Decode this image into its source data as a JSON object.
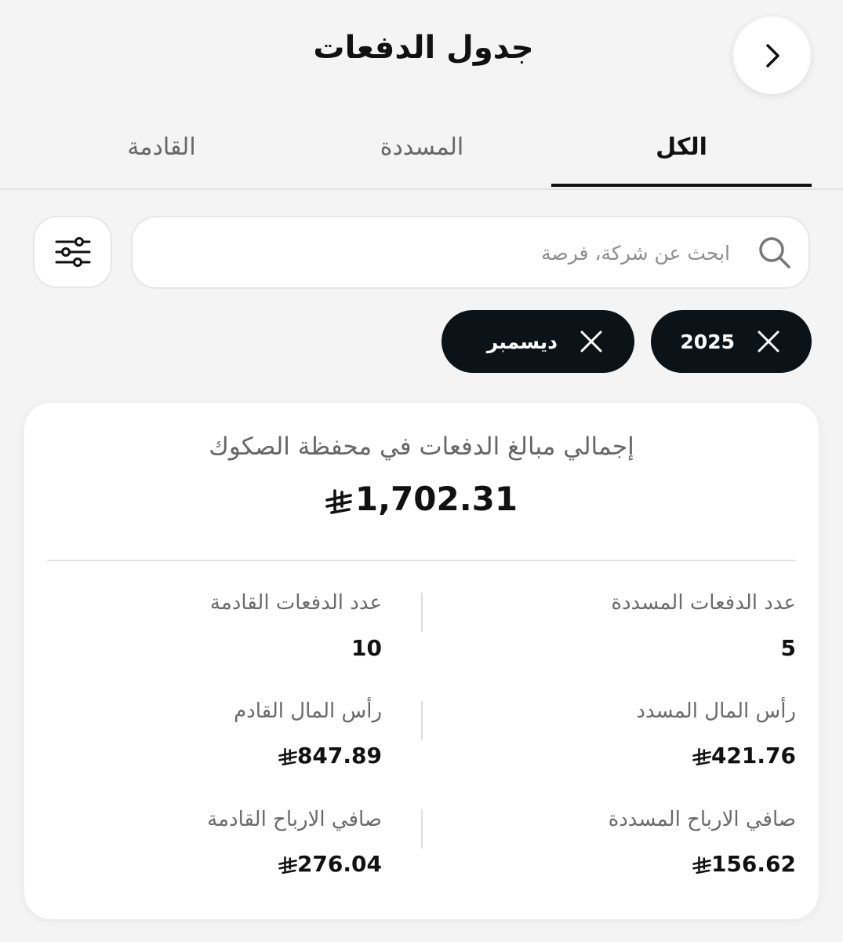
{
  "header": {
    "title": "جدول الدفعات",
    "back_icon": "chevron-right-icon"
  },
  "tabs": [
    {
      "label": "الكل",
      "active": true
    },
    {
      "label": "المسددة",
      "active": false
    },
    {
      "label": "القادمة",
      "active": false
    }
  ],
  "search": {
    "placeholder": "ابحث عن شركة، فرصة",
    "value": ""
  },
  "filters": [
    {
      "label": "2025"
    },
    {
      "label": "ديسمبر"
    }
  ],
  "summary": {
    "title": "إجمالي مبالغ الدفعات في محفظة الصكوك",
    "total": "1,702.31",
    "stats": [
      {
        "label": "عدد الدفعات المسددة",
        "value": "5",
        "currency": false
      },
      {
        "label": "عدد الدفعات القادمة",
        "value": "10",
        "currency": false
      },
      {
        "label": "رأس المال المسدد",
        "value": "421.76",
        "currency": true
      },
      {
        "label": "رأس المال القادم",
        "value": "847.89",
        "currency": true
      },
      {
        "label": "صافي الارباح المسددة",
        "value": "156.62",
        "currency": true
      },
      {
        "label": "صافي الارباح القادمة",
        "value": "276.04",
        "currency": true
      }
    ]
  },
  "colors": {
    "chip_bg": "#0b1218",
    "page_bg": "#f4f4f4",
    "card_bg": "#ffffff"
  }
}
